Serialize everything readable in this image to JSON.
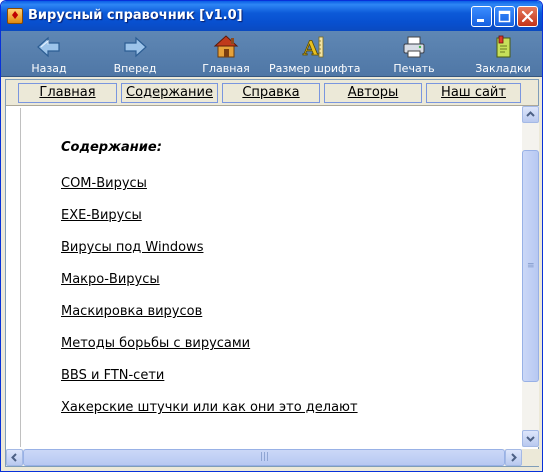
{
  "window": {
    "title": "Вирусный справочник [v1.0]",
    "controls": [
      "minimize",
      "maximize",
      "close"
    ]
  },
  "toolbar": {
    "items": [
      {
        "label": "Назад",
        "icon": "back-arrow-icon"
      },
      {
        "label": "Вперед",
        "icon": "forward-arrow-icon"
      },
      {
        "label": "Главная",
        "icon": "home-icon"
      },
      {
        "label": "Размер шрифта",
        "icon": "font-size-icon",
        "has_dropdown": true
      },
      {
        "label": "Печать",
        "icon": "printer-icon"
      },
      {
        "label": "Закладки",
        "icon": "bookmarks-icon"
      }
    ]
  },
  "nav_tabs": [
    {
      "label": "Главная"
    },
    {
      "label": "Содержание"
    },
    {
      "label": "Справка"
    },
    {
      "label": "Авторы"
    },
    {
      "label": "Наш сайт"
    }
  ],
  "content": {
    "heading": "Содержание:",
    "links": [
      "COM-Вирусы",
      "EXE-Вирусы",
      "Вирусы под Windows",
      "Макро-Вирусы",
      "Маскировка вирусов",
      "Методы борьбы с вирусами",
      "BBS и FTN-сети",
      "Хакерские штучки или как они это делают"
    ]
  },
  "colors": {
    "titlebar": "#0a5ee6",
    "toolbar": "#5a82b0",
    "window_bg": "#ece9d8",
    "close_button": "#c3341a"
  }
}
